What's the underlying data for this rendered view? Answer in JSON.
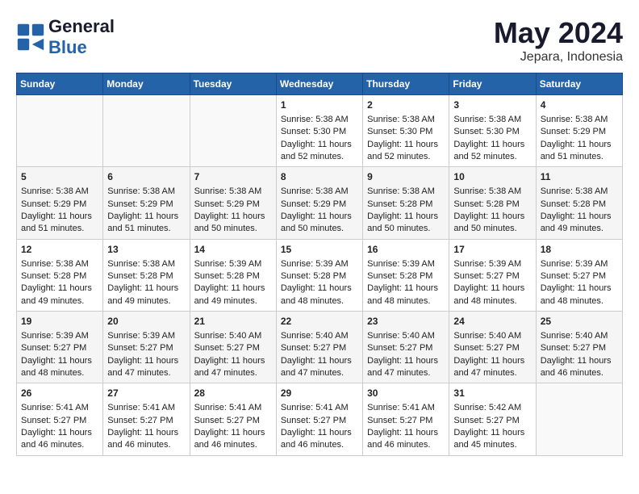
{
  "header": {
    "logo_text_general": "General",
    "logo_text_blue": "Blue",
    "month_title": "May 2024",
    "subtitle": "Jepara, Indonesia"
  },
  "days_of_week": [
    "Sunday",
    "Monday",
    "Tuesday",
    "Wednesday",
    "Thursday",
    "Friday",
    "Saturday"
  ],
  "weeks": [
    [
      {
        "day": "",
        "data": ""
      },
      {
        "day": "",
        "data": ""
      },
      {
        "day": "",
        "data": ""
      },
      {
        "day": "1",
        "data": "Sunrise: 5:38 AM\nSunset: 5:30 PM\nDaylight: 11 hours\nand 52 minutes."
      },
      {
        "day": "2",
        "data": "Sunrise: 5:38 AM\nSunset: 5:30 PM\nDaylight: 11 hours\nand 52 minutes."
      },
      {
        "day": "3",
        "data": "Sunrise: 5:38 AM\nSunset: 5:30 PM\nDaylight: 11 hours\nand 52 minutes."
      },
      {
        "day": "4",
        "data": "Sunrise: 5:38 AM\nSunset: 5:29 PM\nDaylight: 11 hours\nand 51 minutes."
      }
    ],
    [
      {
        "day": "5",
        "data": "Sunrise: 5:38 AM\nSunset: 5:29 PM\nDaylight: 11 hours\nand 51 minutes."
      },
      {
        "day": "6",
        "data": "Sunrise: 5:38 AM\nSunset: 5:29 PM\nDaylight: 11 hours\nand 51 minutes."
      },
      {
        "day": "7",
        "data": "Sunrise: 5:38 AM\nSunset: 5:29 PM\nDaylight: 11 hours\nand 50 minutes."
      },
      {
        "day": "8",
        "data": "Sunrise: 5:38 AM\nSunset: 5:29 PM\nDaylight: 11 hours\nand 50 minutes."
      },
      {
        "day": "9",
        "data": "Sunrise: 5:38 AM\nSunset: 5:28 PM\nDaylight: 11 hours\nand 50 minutes."
      },
      {
        "day": "10",
        "data": "Sunrise: 5:38 AM\nSunset: 5:28 PM\nDaylight: 11 hours\nand 50 minutes."
      },
      {
        "day": "11",
        "data": "Sunrise: 5:38 AM\nSunset: 5:28 PM\nDaylight: 11 hours\nand 49 minutes."
      }
    ],
    [
      {
        "day": "12",
        "data": "Sunrise: 5:38 AM\nSunset: 5:28 PM\nDaylight: 11 hours\nand 49 minutes."
      },
      {
        "day": "13",
        "data": "Sunrise: 5:38 AM\nSunset: 5:28 PM\nDaylight: 11 hours\nand 49 minutes."
      },
      {
        "day": "14",
        "data": "Sunrise: 5:39 AM\nSunset: 5:28 PM\nDaylight: 11 hours\nand 49 minutes."
      },
      {
        "day": "15",
        "data": "Sunrise: 5:39 AM\nSunset: 5:28 PM\nDaylight: 11 hours\nand 48 minutes."
      },
      {
        "day": "16",
        "data": "Sunrise: 5:39 AM\nSunset: 5:28 PM\nDaylight: 11 hours\nand 48 minutes."
      },
      {
        "day": "17",
        "data": "Sunrise: 5:39 AM\nSunset: 5:27 PM\nDaylight: 11 hours\nand 48 minutes."
      },
      {
        "day": "18",
        "data": "Sunrise: 5:39 AM\nSunset: 5:27 PM\nDaylight: 11 hours\nand 48 minutes."
      }
    ],
    [
      {
        "day": "19",
        "data": "Sunrise: 5:39 AM\nSunset: 5:27 PM\nDaylight: 11 hours\nand 48 minutes."
      },
      {
        "day": "20",
        "data": "Sunrise: 5:39 AM\nSunset: 5:27 PM\nDaylight: 11 hours\nand 47 minutes."
      },
      {
        "day": "21",
        "data": "Sunrise: 5:40 AM\nSunset: 5:27 PM\nDaylight: 11 hours\nand 47 minutes."
      },
      {
        "day": "22",
        "data": "Sunrise: 5:40 AM\nSunset: 5:27 PM\nDaylight: 11 hours\nand 47 minutes."
      },
      {
        "day": "23",
        "data": "Sunrise: 5:40 AM\nSunset: 5:27 PM\nDaylight: 11 hours\nand 47 minutes."
      },
      {
        "day": "24",
        "data": "Sunrise: 5:40 AM\nSunset: 5:27 PM\nDaylight: 11 hours\nand 47 minutes."
      },
      {
        "day": "25",
        "data": "Sunrise: 5:40 AM\nSunset: 5:27 PM\nDaylight: 11 hours\nand 46 minutes."
      }
    ],
    [
      {
        "day": "26",
        "data": "Sunrise: 5:41 AM\nSunset: 5:27 PM\nDaylight: 11 hours\nand 46 minutes."
      },
      {
        "day": "27",
        "data": "Sunrise: 5:41 AM\nSunset: 5:27 PM\nDaylight: 11 hours\nand 46 minutes."
      },
      {
        "day": "28",
        "data": "Sunrise: 5:41 AM\nSunset: 5:27 PM\nDaylight: 11 hours\nand 46 minutes."
      },
      {
        "day": "29",
        "data": "Sunrise: 5:41 AM\nSunset: 5:27 PM\nDaylight: 11 hours\nand 46 minutes."
      },
      {
        "day": "30",
        "data": "Sunrise: 5:41 AM\nSunset: 5:27 PM\nDaylight: 11 hours\nand 46 minutes."
      },
      {
        "day": "31",
        "data": "Sunrise: 5:42 AM\nSunset: 5:27 PM\nDaylight: 11 hours\nand 45 minutes."
      },
      {
        "day": "",
        "data": ""
      }
    ]
  ]
}
